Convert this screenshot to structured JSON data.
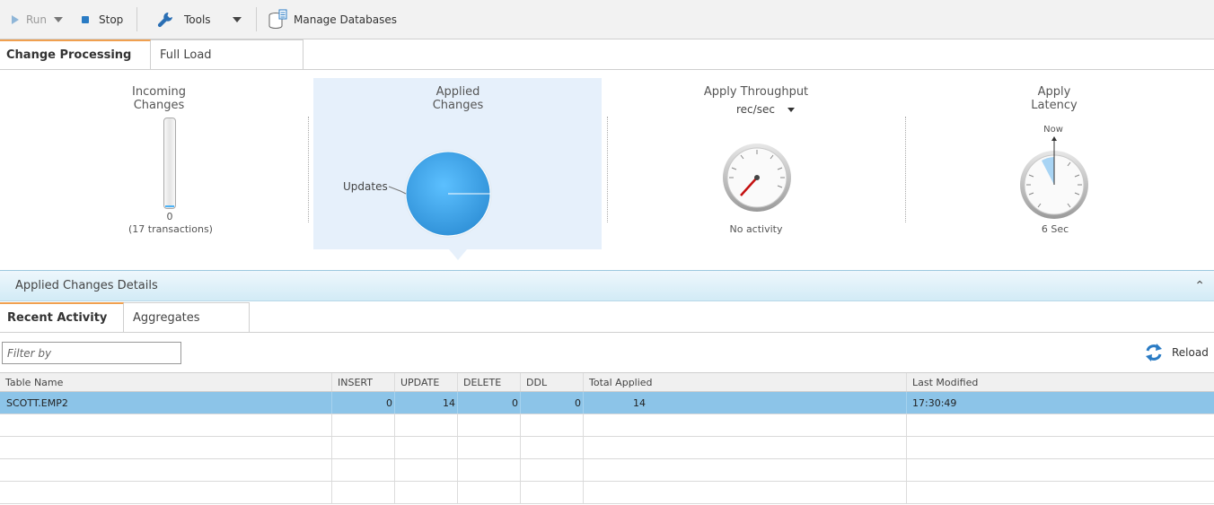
{
  "toolbar": {
    "run_label": "Run",
    "stop_label": "Stop",
    "tools_label": "Tools",
    "manage_label": "Manage Databases"
  },
  "main_tabs": [
    {
      "label": "Change Processing",
      "active": true
    },
    {
      "label": "Full Load",
      "active": false
    }
  ],
  "metrics": {
    "incoming": {
      "title_line1": "Incoming",
      "title_line2": "Changes",
      "value": "0",
      "transactions": "(17 transactions)",
      "fill_fraction": 0.0
    },
    "applied": {
      "title_line1": "Applied",
      "title_line2": "Changes",
      "slice_label": "Updates"
    },
    "throughput": {
      "title": "Apply Throughput",
      "unit": "rec/sec",
      "status": "No activity"
    },
    "latency": {
      "title_line1": "Apply",
      "title_line2": "Latency",
      "marker": "Now",
      "value": "6 Sec"
    }
  },
  "details": {
    "header": "Applied Changes Details",
    "tabs": [
      {
        "label": "Recent Activity",
        "active": true
      },
      {
        "label": "Aggregates",
        "active": false
      }
    ],
    "filter_placeholder": "Filter by",
    "reload_label": "Reload",
    "columns": [
      "Table Name",
      "INSERT",
      "UPDATE",
      "DELETE",
      "DDL",
      "Total Applied",
      "Last Modified"
    ],
    "rows": [
      {
        "table": "SCOTT.EMP2",
        "insert": "0",
        "update": "14",
        "delete": "0",
        "ddl": "0",
        "total": "14",
        "last_modified": "17:30:49"
      }
    ]
  },
  "colors": {
    "accent_tab": "#f0a050",
    "selected_row": "#8cc4e8",
    "pie_fill": "#4db3f7",
    "applied_panel": "#e6f0fb"
  }
}
